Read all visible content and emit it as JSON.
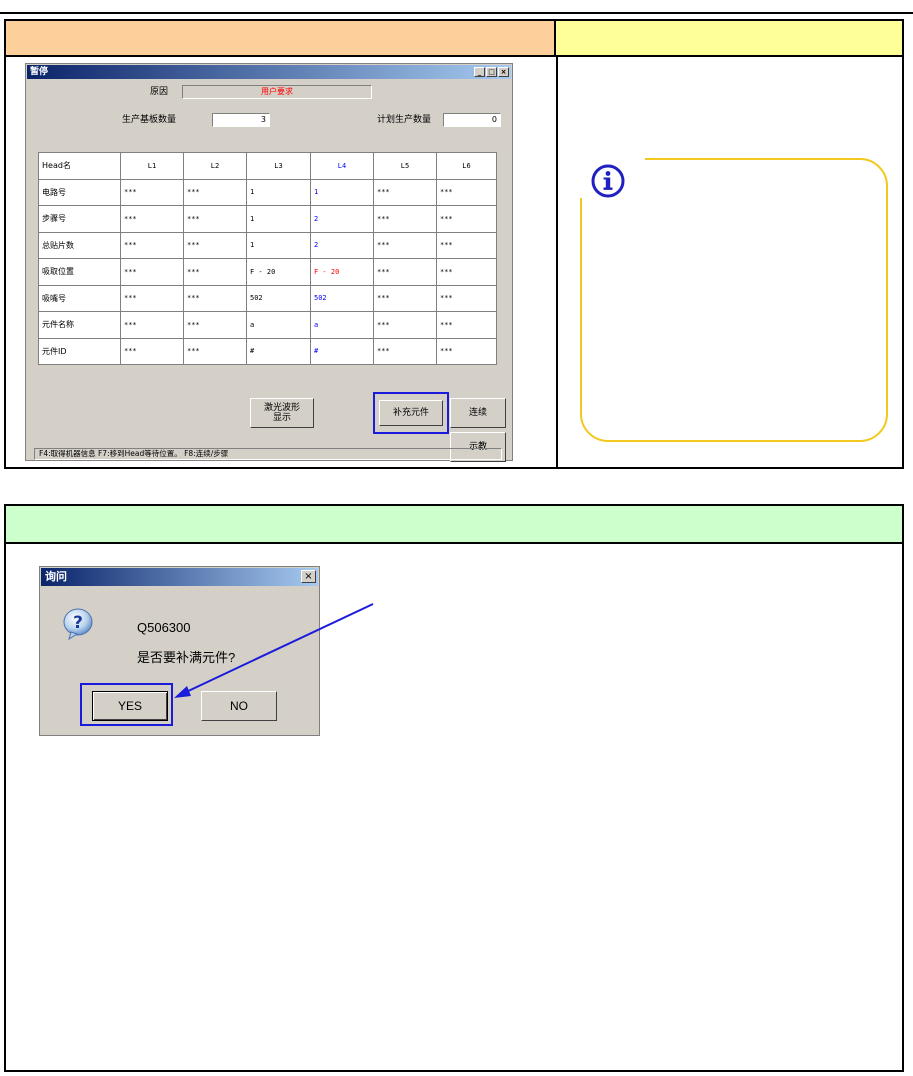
{
  "pause_window": {
    "title": "暂停",
    "controls": {
      "minimize": "_",
      "maximize": "□",
      "close": "×"
    },
    "reason_label": "原因",
    "reason_value": "用户要求",
    "produced_label": "生产基板数量",
    "produced_value": "3",
    "planned_label": "计划生产数量",
    "planned_value": "0",
    "table": {
      "columns": [
        "Head名",
        "L1",
        "L2",
        "L3",
        "L4",
        "L5",
        "L6"
      ],
      "rows": [
        {
          "label": "电路号",
          "cells": [
            "***",
            "***",
            "1",
            "1",
            "***",
            "***"
          ]
        },
        {
          "label": "步骤号",
          "cells": [
            "***",
            "***",
            "1",
            "2",
            "***",
            "***"
          ]
        },
        {
          "label": "总贴片数",
          "cells": [
            "***",
            "***",
            "1",
            "2",
            "***",
            "***"
          ]
        },
        {
          "label": "吸取位置",
          "cells": [
            "***",
            "***",
            "F - 20",
            "F - 20",
            "***",
            "***"
          ]
        },
        {
          "label": "吸嘴号",
          "cells": [
            "***",
            "***",
            "502",
            "502",
            "***",
            "***"
          ]
        },
        {
          "label": "元件名称",
          "cells": [
            "***",
            "***",
            "a",
            "a",
            "***",
            "***"
          ]
        },
        {
          "label": "元件ID",
          "cells": [
            "***",
            "***",
            "#",
            "#",
            "***",
            "***"
          ]
        }
      ]
    },
    "buttons": {
      "laser_line1": "激光波形",
      "laser_line2": "显示",
      "replenish": "补充元件",
      "continue": "连续",
      "teach": "示教"
    },
    "status_bar": "F4:取得机器信息  F7:移到Head等待位置。  F8:连续/步骤"
  },
  "query_dialog": {
    "title": "询问",
    "close": "×",
    "code": "Q506300",
    "message": "是否要补满元件?",
    "yes": "YES",
    "no": "NO"
  },
  "colors": {
    "header_orange": "#fdcf9b",
    "header_yellow": "#ffff9a",
    "header_green": "#ccffcc",
    "highlight_blue": "#1b1bdc",
    "info_border": "#f3c81c"
  },
  "icons": [
    "info-icon",
    "question-icon",
    "arrow-pointer"
  ]
}
